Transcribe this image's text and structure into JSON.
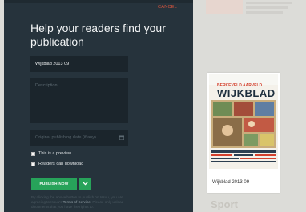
{
  "header": {
    "cancel_label": "CANCEL"
  },
  "title": "Help your readers find your publication",
  "form": {
    "title_value": "Wijkblad 2013 09",
    "description_placeholder": "Description",
    "date_placeholder": "Original publishing date (if any)",
    "preview_label": "This is a preview",
    "download_label": "Readers can download",
    "publish_label": "PUBLISH NOW",
    "terms_prefix": "By clicking the above button to publish on Issuu, you are agreeing to Issuu's ",
    "terms_link": "Terms of Service",
    "terms_suffix": ". Please only upload documents that you have the rights to."
  },
  "preview": {
    "caption": "Wijkblad 2013 09",
    "cover_mast_small": "BERKEVELD AARVELD",
    "cover_mast": "WIJKBLAD"
  },
  "background": {
    "faded_sport": "Sport"
  },
  "colors": {
    "panel": "#26333c",
    "field": "#1b252c",
    "accent_green": "#27a35a",
    "cancel": "#e0553c"
  }
}
